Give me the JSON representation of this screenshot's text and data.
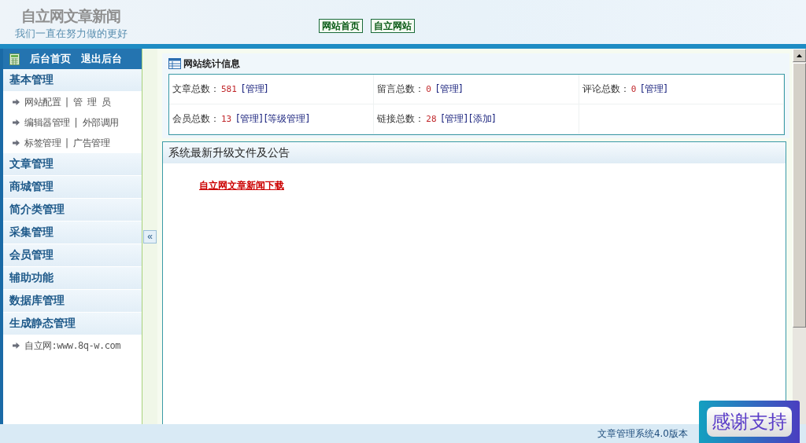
{
  "header": {
    "logo_title": "自立网文章新闻",
    "logo_slogan": "我们一直在努力做的更好",
    "nav_links": [
      "网站首页",
      "自立网站"
    ]
  },
  "sidebar": {
    "top_links": [
      "后台首页",
      "退出后台"
    ],
    "groups": [
      {
        "title": "基本管理",
        "separator": "|",
        "lines": [
          {
            "links": [
              "网站配置",
              "管 理 员"
            ]
          },
          {
            "links": [
              "编辑器管理",
              "外部调用"
            ]
          },
          {
            "links": [
              "标签管理",
              "广告管理"
            ]
          }
        ]
      },
      {
        "title": "文章管理"
      },
      {
        "title": "商城管理"
      },
      {
        "title": "简介类管理"
      },
      {
        "title": "采集管理"
      },
      {
        "title": "会员管理"
      },
      {
        "title": "辅助功能"
      },
      {
        "title": "数据库管理"
      },
      {
        "title": "生成静态管理",
        "lines": [
          {
            "links": [
              "自立网:www.8q-w.com"
            ]
          }
        ]
      }
    ]
  },
  "collapse_button": "«",
  "stats": {
    "title": "网站统计信息",
    "rows": [
      [
        {
          "label": "文章总数：",
          "value": "581",
          "links": [
            "[管理]"
          ]
        },
        {
          "label": "留言总数：",
          "value": "0",
          "links": [
            "[管理]"
          ]
        },
        {
          "label": "评论总数：",
          "value": "0",
          "links": [
            "[管理]"
          ]
        }
      ],
      [
        {
          "label": "会员总数：",
          "value": "13",
          "links": [
            "[管理]",
            "[等级管理]"
          ]
        },
        {
          "label": "链接总数：",
          "value": "28",
          "links": [
            "[管理]",
            "[添加]"
          ]
        }
      ]
    ]
  },
  "announcements": {
    "title": "系统最新升级文件及公告",
    "links": [
      "自立网文章新闻下载"
    ]
  },
  "footer": {
    "version": "文章管理系统4.0版本",
    "badge": "感谢支持"
  }
}
